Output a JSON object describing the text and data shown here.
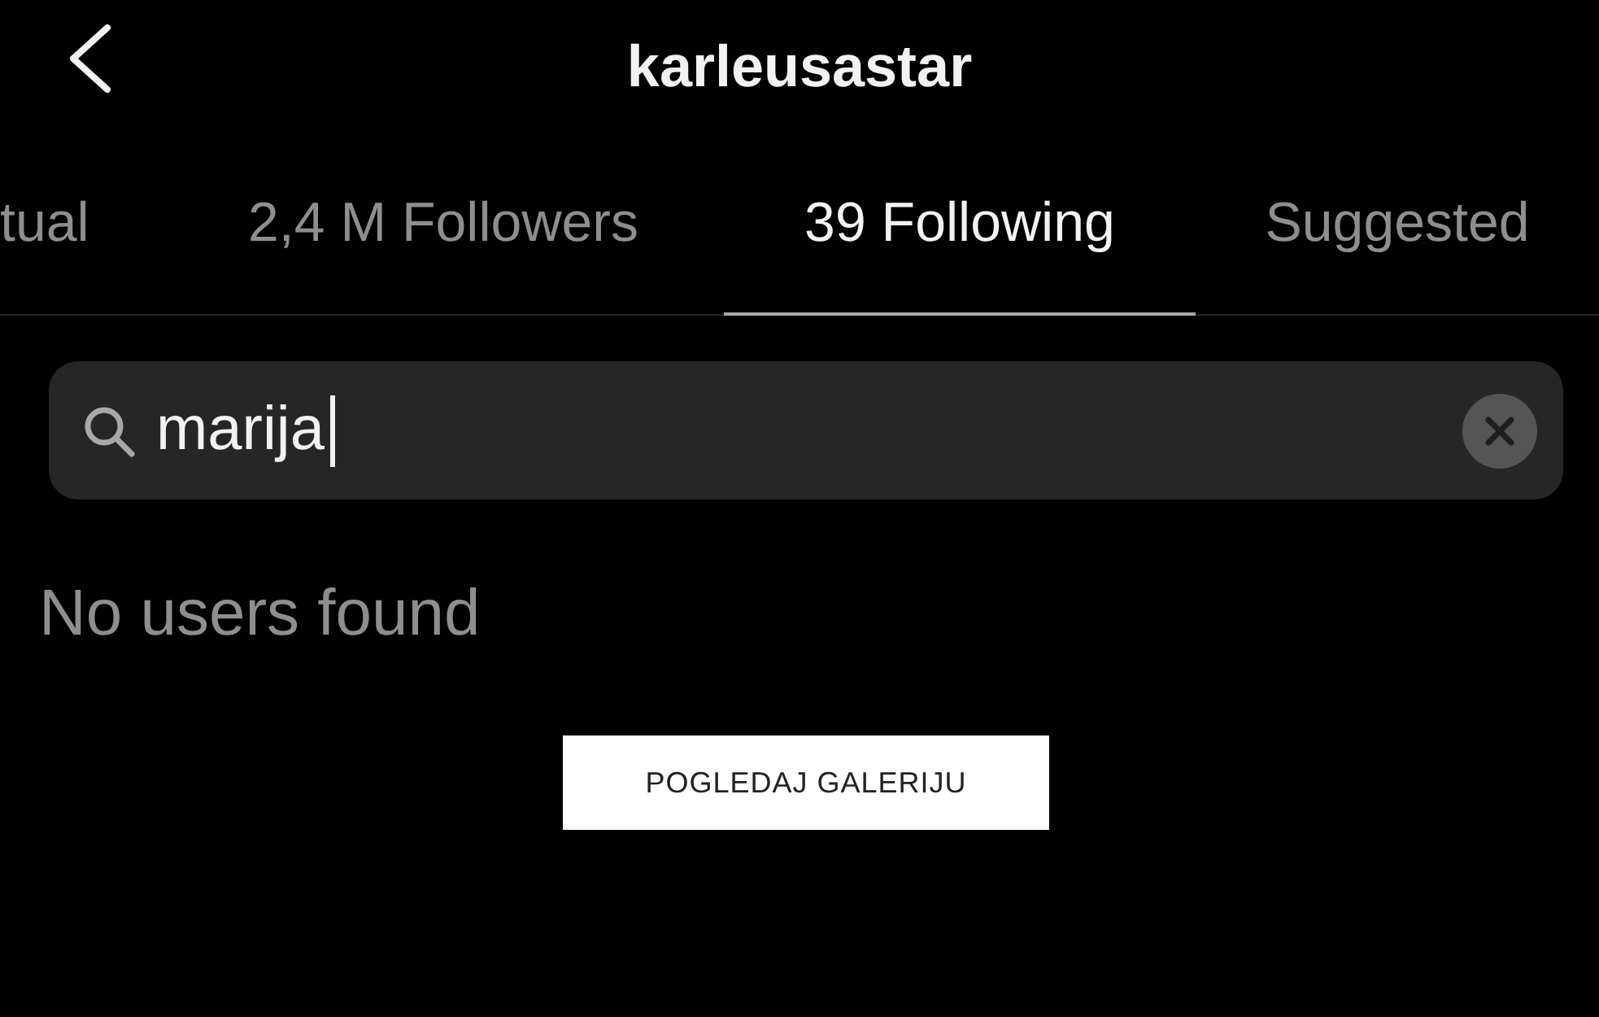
{
  "header": {
    "title": "karleusastar"
  },
  "tabs": [
    {
      "label": "tual",
      "selected": false
    },
    {
      "label": "2,4 M Followers",
      "selected": false
    },
    {
      "label": "39 Following",
      "selected": true
    },
    {
      "label": "Suggested",
      "selected": false
    }
  ],
  "search": {
    "value": "marija"
  },
  "message": "No users found",
  "overlay_button": "POGLEDAJ GALERIJU"
}
